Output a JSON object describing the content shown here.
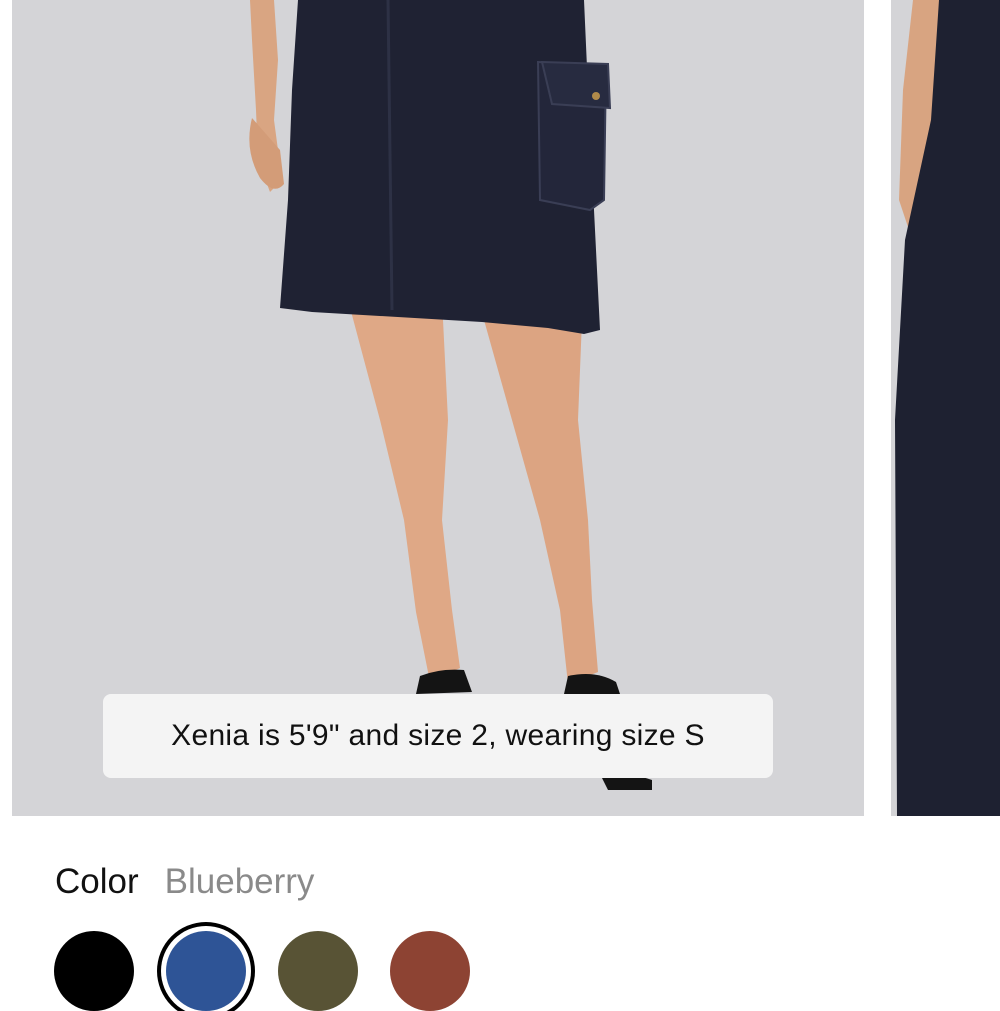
{
  "gallery": {
    "caption": "Xenia is 5'9\" and size 2, wearing size S"
  },
  "color_picker": {
    "label": "Color",
    "selected_value": "Blueberry",
    "swatches": [
      {
        "color": "#000000",
        "selected": false
      },
      {
        "color": "#2e5496",
        "selected": true
      },
      {
        "color": "#585335",
        "selected": false
      },
      {
        "color": "#8d4333",
        "selected": false
      }
    ]
  }
}
